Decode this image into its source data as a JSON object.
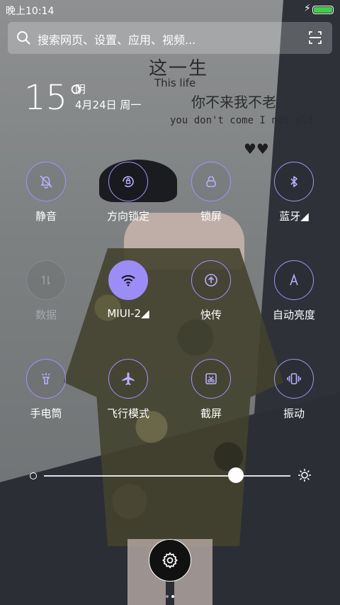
{
  "status_bar": {
    "time": "晚上10:14",
    "battery_color": "#3ecf4a"
  },
  "search": {
    "placeholder": "搜索网页、设置、应用、视频..."
  },
  "wallpaper": {
    "title": "这一生",
    "subtitle_en": "This life",
    "line_cn": "你不来我不老",
    "line_en": "you don't come I not old",
    "hearts": "♥♥"
  },
  "weather": {
    "temperature": "15°",
    "condition": "阴",
    "date": "4月24日 周一"
  },
  "toggles": [
    {
      "label": "静音",
      "icon": "bell-off-icon",
      "state": "off"
    },
    {
      "label": "方向锁定",
      "icon": "rotation-lock-icon",
      "state": "off"
    },
    {
      "label": "锁屏",
      "icon": "lock-icon",
      "state": "off"
    },
    {
      "label": "蓝牙◢",
      "icon": "bluetooth-icon",
      "state": "off"
    },
    {
      "label": "数据",
      "icon": "mobile-data-icon",
      "state": "disabled"
    },
    {
      "label": "MIUI-2◢",
      "icon": "wifi-icon",
      "state": "on"
    },
    {
      "label": "快传",
      "icon": "quick-transfer-icon",
      "state": "off"
    },
    {
      "label": "自动亮度",
      "icon": "auto-brightness-icon",
      "state": "off"
    },
    {
      "label": "手电筒",
      "icon": "flashlight-icon",
      "state": "off"
    },
    {
      "label": "飞行模式",
      "icon": "airplane-icon",
      "state": "off"
    },
    {
      "label": "截屏",
      "icon": "screenshot-icon",
      "state": "off"
    },
    {
      "label": "振动",
      "icon": "vibrate-icon",
      "state": "off"
    }
  ],
  "brightness": {
    "level": 0.78
  },
  "pager": {
    "pages": 2,
    "current": 2
  },
  "colors": {
    "accent": "#9b8df5"
  }
}
